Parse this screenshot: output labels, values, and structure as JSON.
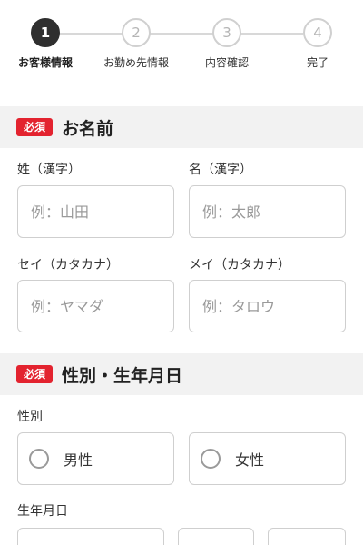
{
  "stepper": {
    "steps": [
      {
        "number": "1",
        "label": "お客様情報"
      },
      {
        "number": "2",
        "label": "お勤め先情報"
      },
      {
        "number": "3",
        "label": "内容確認"
      },
      {
        "number": "4",
        "label": "完了"
      }
    ]
  },
  "name_section": {
    "badge": "必須",
    "title": "お名前",
    "last_name_kanji": {
      "label": "姓（漢字）",
      "placeholder": "例：山田"
    },
    "first_name_kanji": {
      "label": "名（漢字）",
      "placeholder": "例：太郎"
    },
    "last_name_kana": {
      "label": "セイ（カタカナ）",
      "placeholder": "例：ヤマダ"
    },
    "first_name_kana": {
      "label": "メイ（カタカナ）",
      "placeholder": "例：タロウ"
    }
  },
  "gender_section": {
    "badge": "必須",
    "title": "性別・生年月日",
    "gender_label": "性別",
    "options": [
      {
        "label": "男性"
      },
      {
        "label": "女性"
      }
    ],
    "birthdate_label": "生年月日"
  }
}
